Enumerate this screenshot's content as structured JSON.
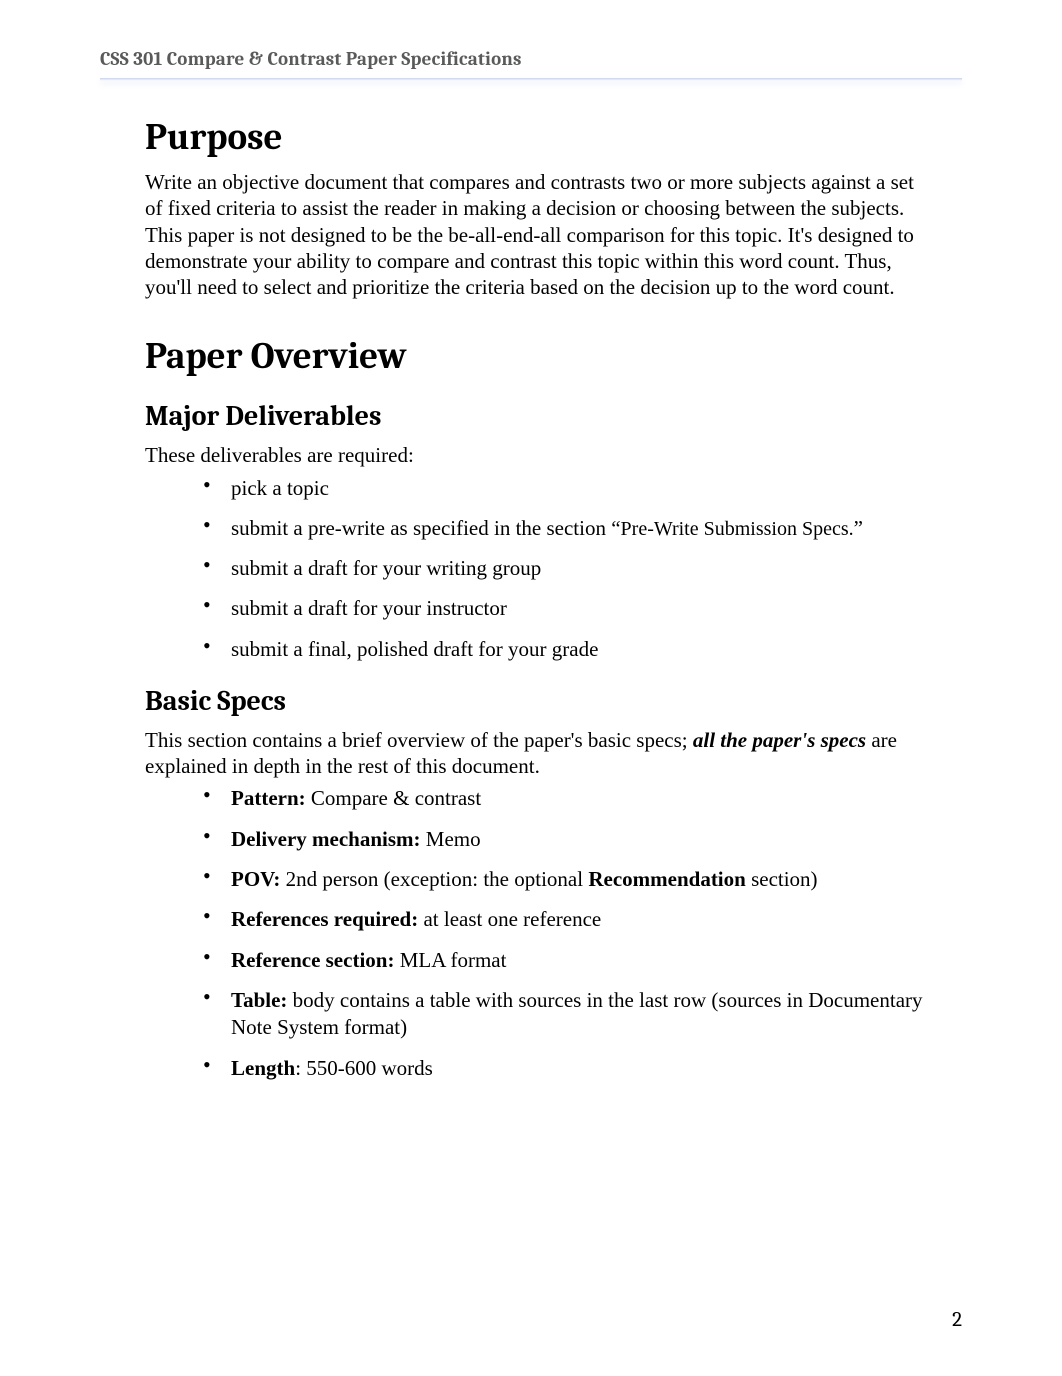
{
  "header": {
    "running_title": "CSS 301 Compare & Contrast Paper Specifications"
  },
  "sections": {
    "purpose": {
      "heading": "Purpose",
      "body": "Write an objective document that compares and contrasts two or more subjects against a set of fixed criteria to assist the reader in making a decision or choosing between the subjects. This paper is not designed to be the be-all-end-all comparison for this topic. It's designed to demonstrate your ability to compare and contrast this topic within this word count. Thus, you'll need to select and prioritize the criteria based on the decision up to the word count."
    },
    "overview": {
      "heading": "Paper Overview",
      "deliverables": {
        "heading": "Major Deliverables",
        "intro": "These deliverables are required:",
        "items": [
          {
            "text": "pick a topic"
          },
          {
            "prefix": "submit a pre-write as specified in the section “",
            "ref": "Pre-Write Submission Specs.",
            "suffix": "”"
          },
          {
            "text": "submit a draft for your writing group"
          },
          {
            "text": "submit a draft for your instructor"
          },
          {
            "text": "submit a final, polished draft for your grade"
          }
        ]
      },
      "basic_specs": {
        "heading": "Basic Specs",
        "intro_pre": "This section contains a brief overview of the paper's basic specs; ",
        "intro_em": "all the paper's specs",
        "intro_post": " are explained in depth in the rest of this document.",
        "items": [
          {
            "label": "Pattern:",
            "value": " Compare & contrast"
          },
          {
            "label": "Delivery mechanism:",
            "value": " Memo"
          },
          {
            "label": "POV:",
            "value_pre": " 2nd person (exception: the optional ",
            "value_bold": "Recommendation",
            "value_post": " section)"
          },
          {
            "label": "References required:",
            "value": " at least one reference"
          },
          {
            "label": "Reference section:",
            "value": " MLA format"
          },
          {
            "label": "Table:",
            "value": " body contains a table with sources in the last row (sources in Documentary Note System format)"
          },
          {
            "label": "Length",
            "value": ": 550-600 words"
          }
        ]
      }
    }
  },
  "page_number": "2"
}
